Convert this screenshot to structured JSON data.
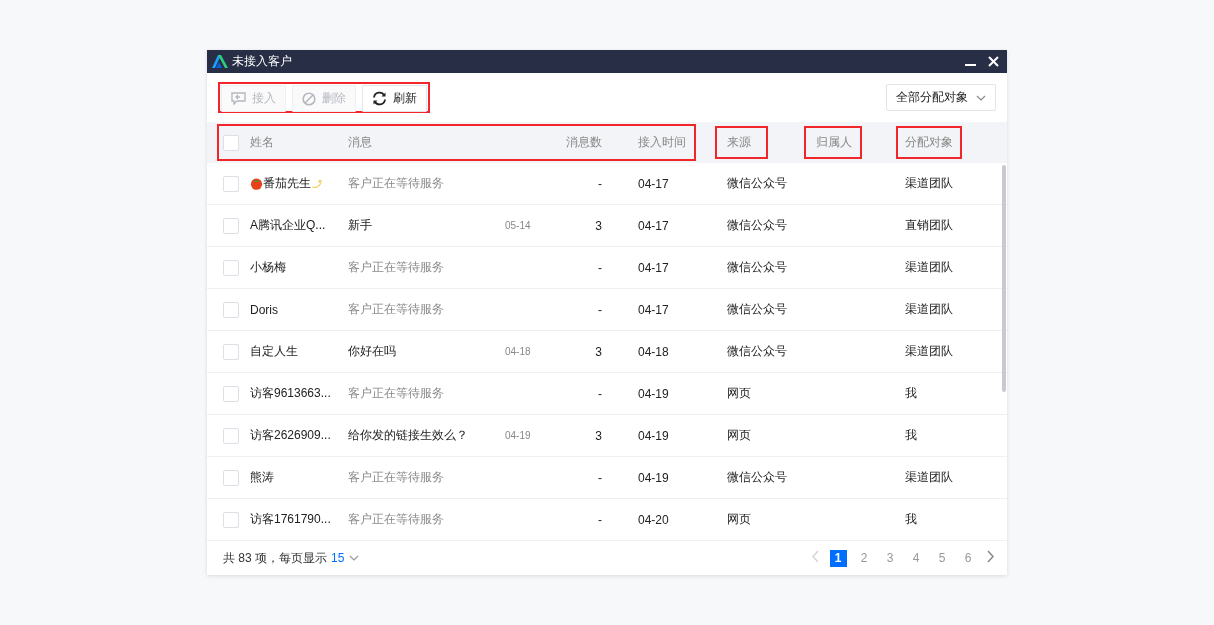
{
  "window": {
    "title": "未接入客户"
  },
  "toolbar": {
    "highlighted": true,
    "buttons": [
      {
        "label": "接入",
        "kind": "connect",
        "disabled": true
      },
      {
        "label": "删除",
        "kind": "delete",
        "disabled": true
      },
      {
        "label": "刷新",
        "kind": "refresh",
        "disabled": false
      }
    ]
  },
  "filter": {
    "value": "全部分配对象"
  },
  "table": {
    "select_all_checked": false,
    "header_groups": [
      {
        "highlighted": true,
        "columns": [
          "姓名",
          "消息",
          "消息数",
          "接入时间"
        ]
      },
      {
        "highlighted": true,
        "columns": [
          "来源"
        ]
      },
      {
        "highlighted": true,
        "columns": [
          "归属人"
        ]
      },
      {
        "highlighted": true,
        "columns": [
          "分配对象"
        ]
      }
    ],
    "rows": [
      {
        "checked": false,
        "name": "番茄先生",
        "decorated": true,
        "message": "客户正在等待服务",
        "kind": "waiting",
        "count": "-",
        "time": "04-17",
        "source": "微信公众号",
        "assignee": "渠道团队"
      },
      {
        "checked": false,
        "name": "A腾讯企业Q...",
        "decorated": false,
        "message": "新手",
        "kind": "message",
        "message_time": "05-14",
        "count": "3",
        "time": "04-17",
        "source": "微信公众号",
        "assignee": "直销团队"
      },
      {
        "checked": false,
        "name": "小杨梅",
        "decorated": false,
        "message": "客户正在等待服务",
        "kind": "waiting",
        "count": "-",
        "time": "04-17",
        "source": "微信公众号",
        "assignee": "渠道团队"
      },
      {
        "checked": false,
        "name": "Doris",
        "decorated": false,
        "message": "客户正在等待服务",
        "kind": "waiting",
        "count": "-",
        "time": "04-17",
        "source": "微信公众号",
        "assignee": "渠道团队"
      },
      {
        "checked": false,
        "name": "自定人生",
        "decorated": false,
        "message": "你好在吗",
        "kind": "message",
        "message_time": "04-18",
        "count": "3",
        "time": "04-18",
        "source": "微信公众号",
        "assignee": "渠道团队"
      },
      {
        "checked": false,
        "name": "访客9613663...",
        "decorated": false,
        "message": "客户正在等待服务",
        "kind": "waiting",
        "count": "-",
        "time": "04-19",
        "source": "网页",
        "assignee": "我"
      },
      {
        "checked": false,
        "name": "访客2626909...",
        "decorated": false,
        "message": "给你发的链接生效么？",
        "kind": "message",
        "message_time": "04-19",
        "count": "3",
        "time": "04-19",
        "source": "网页",
        "assignee": "我"
      },
      {
        "checked": false,
        "name": "熊涛",
        "decorated": false,
        "message": "客户正在等待服务",
        "kind": "waiting",
        "count": "-",
        "time": "04-19",
        "source": "微信公众号",
        "assignee": "渠道团队"
      },
      {
        "checked": false,
        "name": "访客1761790...",
        "decorated": false,
        "message": "客户正在等待服务",
        "kind": "waiting",
        "count": "-",
        "time": "04-20",
        "source": "网页",
        "assignee": "我"
      }
    ]
  },
  "footer": {
    "total_text": "共 83 项，每页显示",
    "page_size": "15",
    "prev_disabled": true,
    "next_disabled": false,
    "pages": [
      {
        "label": "1",
        "selected": true
      },
      {
        "label": "2",
        "selected": false
      },
      {
        "label": "3",
        "selected": false
      },
      {
        "label": "4",
        "selected": false
      },
      {
        "label": "5",
        "selected": false
      },
      {
        "label": "6",
        "selected": false
      }
    ]
  }
}
